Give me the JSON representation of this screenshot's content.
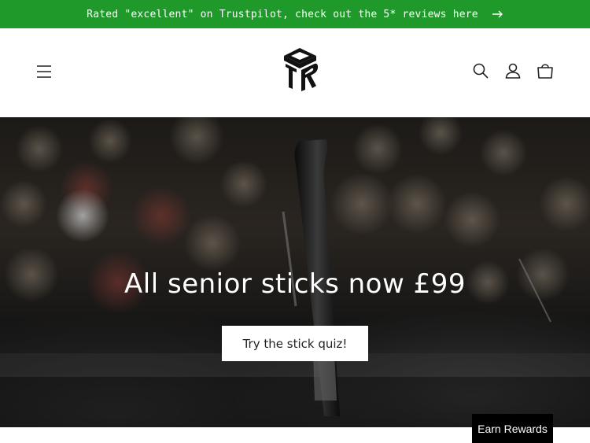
{
  "announcement": {
    "text": "Rated \"excellent\" on Trustpilot, check out the 5* reviews here",
    "icon": "arrow-right-icon"
  },
  "header": {
    "menu_icon": "hamburger-menu-icon",
    "logo_icon": "brand-logo",
    "search_icon": "search-icon",
    "account_icon": "account-icon",
    "cart_icon": "cart-icon"
  },
  "hero": {
    "title": "All senior sticks now £99",
    "button_label": "Try the stick quiz!"
  },
  "rewards": {
    "label": "Earn Rewards"
  },
  "colors": {
    "announcement_bg": "#1f9a2a",
    "rewards_bg": "#000000"
  }
}
